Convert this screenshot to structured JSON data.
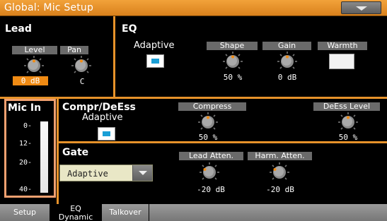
{
  "title": "Global: Mic Setup",
  "lead": {
    "section": "Lead",
    "level_label": "Level",
    "pan_label": "Pan",
    "level_value": "0 dB",
    "pan_value": "C"
  },
  "eq": {
    "section": "EQ",
    "adaptive_label": "Adaptive",
    "adaptive_on": true,
    "shape_label": "Shape",
    "shape_value": "50 %",
    "gain_label": "Gain",
    "gain_value": "0 dB",
    "warmth_label": "Warmth",
    "warmth_on": false
  },
  "mic_in": {
    "section": "Mic In",
    "ticks": [
      "0-",
      "12-",
      "20-",
      "40-"
    ]
  },
  "compr": {
    "section": "Compr/DeEss",
    "adaptive_label": "Adaptive",
    "adaptive_on": true,
    "compress_label": "Compress",
    "compress_value": "50 %",
    "deess_label": "DeEss Level",
    "deess_value": "50 %"
  },
  "gate": {
    "section": "Gate",
    "mode_value": "Adaptive",
    "lead_atten_label": "Lead Atten.",
    "lead_atten_value": "-20 dB",
    "harm_atten_label": "Harm. Atten.",
    "harm_atten_value": "-20 dB"
  },
  "tabs": [
    {
      "label": "Setup",
      "active": false
    },
    {
      "label_line1": "EQ",
      "label_line2": "Dynamic",
      "active": true
    },
    {
      "label": "Talkover",
      "active": false
    }
  ],
  "colors": {
    "accent": "#e6922a",
    "led_on": "#1a9fd6",
    "value_box": "#f08b14",
    "micbox_border": "#f0a070"
  },
  "icons": {
    "menu": "triangle-down-icon",
    "knob": "knob-icon",
    "dropdown_arrow": "chevron-down-icon"
  }
}
